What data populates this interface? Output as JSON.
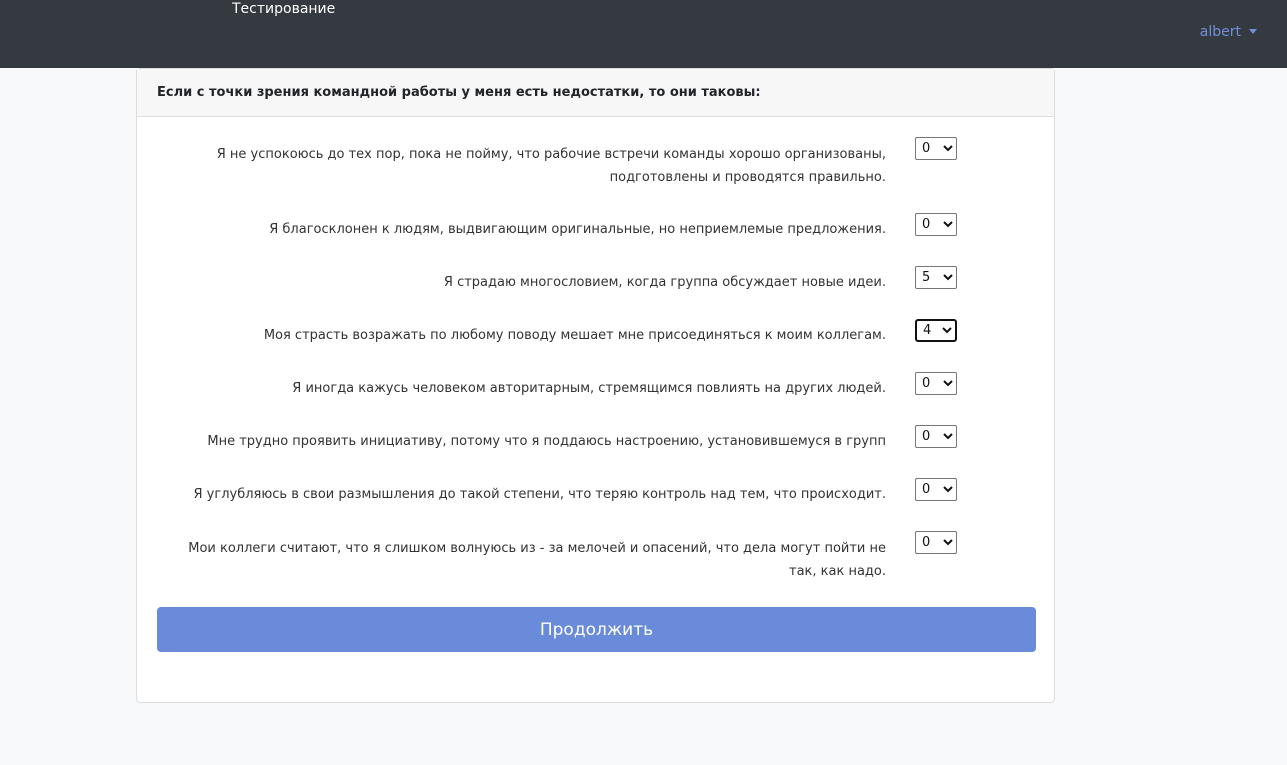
{
  "navbar": {
    "brand": "Тестирование",
    "user": "albert"
  },
  "card": {
    "header": "Если с точки зрения командной работы у меня есть недостатки, то они таковы:"
  },
  "questions": [
    {
      "text": "Я не успокоюсь до тех пор, пока не пойму, что рабочие встречи команды хорошо организованы, подготовлены и проводятся правильно.",
      "value": "0"
    },
    {
      "text": "Я благосклонен к людям, выдвигающим оригинальные, но неприемлемые предложения.",
      "value": "0"
    },
    {
      "text": "Я страдаю многословием, когда группа обсуждает новые идеи.",
      "value": "5"
    },
    {
      "text": "Моя страсть возражать по любому поводу мешает мне присоединяться к моим коллегам.",
      "value": "4"
    },
    {
      "text": "Я иногда кажусь человеком авторитарным, стремящимся повлиять на других людей.",
      "value": "0"
    },
    {
      "text": "Мне трудно проявить инициативу, потому что я поддаюсь настроению, установившемуся в групп",
      "value": "0"
    },
    {
      "text": "Я углубляюсь в свои размышления до такой степени, что теряю контроль над тем, что происходит.",
      "value": "0"
    },
    {
      "text": "Мои коллеги считают, что я слишком волнуюсь из - за мелочей и опасений, что дела могут пойти не так, как надо.",
      "value": "0"
    }
  ],
  "continue_label": "Продолжить"
}
